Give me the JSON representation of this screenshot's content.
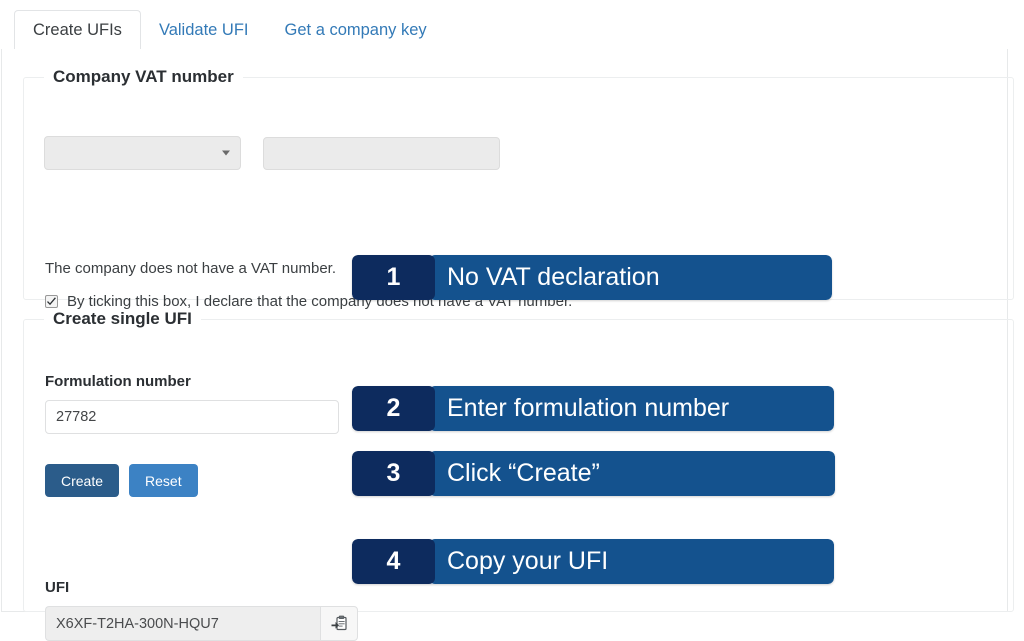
{
  "tabs": [
    {
      "label": "Create UFIs",
      "active": true
    },
    {
      "label": "Validate UFI",
      "active": false
    },
    {
      "label": "Get a company key",
      "active": false
    }
  ],
  "vat_section": {
    "legend": "Company VAT number",
    "country_select_value": "",
    "vat_number_value": "",
    "status_text": "The company does not have a VAT number.",
    "declaration_label": "By ticking this box, I declare that the company does not have a VAT number.",
    "declaration_checked": true
  },
  "ufi_section": {
    "legend": "Create single UFI",
    "formulation_label": "Formulation number",
    "formulation_value": "27782",
    "formulation_placeholder": "",
    "create_button": "Create",
    "reset_button": "Reset",
    "ufi_label": "UFI",
    "ufi_value": "X6XF-T2HA-300N-HQU7",
    "copy_icon": "clipboard-copy-icon"
  },
  "annotations": [
    {
      "number": "1",
      "text": "No VAT declaration"
    },
    {
      "number": "2",
      "text": "Enter formulation number"
    },
    {
      "number": "3",
      "text": "Click “Create”"
    },
    {
      "number": "4",
      "text": "Copy your UFI"
    }
  ],
  "colors": {
    "annotation_number_bg": "#0d2b5e",
    "annotation_body_bg": "#14528e",
    "tab_link": "#337ab7",
    "create_button_bg": "#2b5c8a",
    "reset_button_bg": "#3c82c4"
  }
}
